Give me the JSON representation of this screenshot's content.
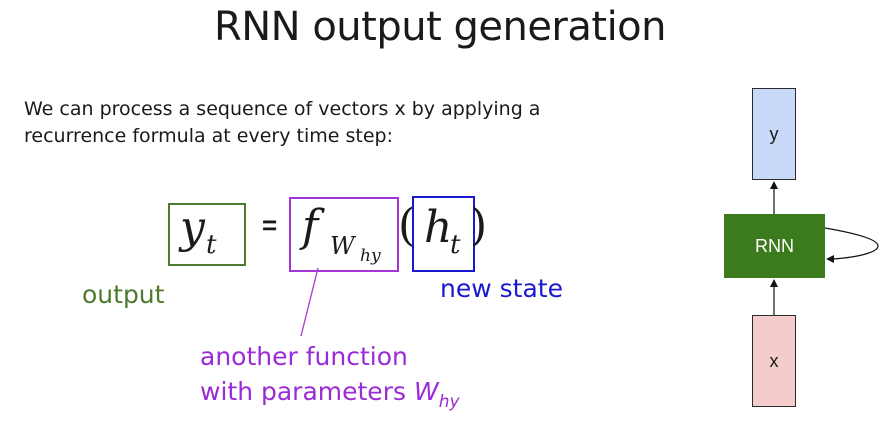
{
  "title": "RNN output generation",
  "description": {
    "line1": "We can process a sequence of vectors x by applying a",
    "line2": "recurrence formula at every time step:"
  },
  "equation": {
    "y": "y",
    "y_sub": "t",
    "equals": "=",
    "f": "f",
    "f_sub": "W",
    "f_subsub": "hy",
    "open_paren": "(",
    "h": "h",
    "h_sub": "t",
    "close_paren": ")"
  },
  "labels": {
    "output": "output",
    "new_state": "new state",
    "another_line1": "another function",
    "another_line2_prefix": "with parameters ",
    "another_W": "W",
    "another_W_sub": "hy"
  },
  "diagram": {
    "top_box": "y",
    "middle_box": "RNN",
    "bottom_box": "x"
  },
  "colors": {
    "output": "#4c7a2e",
    "function": "#9a2bd6",
    "state": "#1a1acc",
    "rnn_box": "#3c7a1e",
    "y_box": "#c9daf8",
    "x_box": "#f4cccc"
  }
}
